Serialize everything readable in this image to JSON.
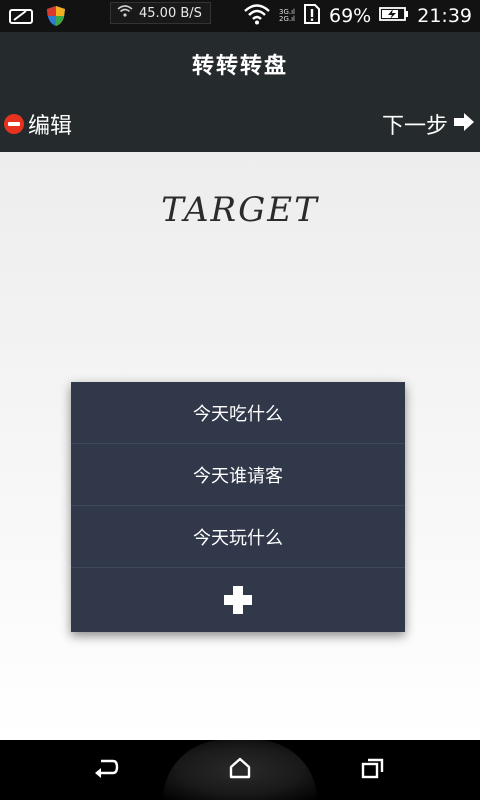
{
  "status_bar": {
    "network_speed": "45.00 B/S",
    "net_3g": "3G.ıl",
    "net_2g": "2G.ıl",
    "battery_percent": "69%",
    "time": "21:39"
  },
  "header": {
    "title": "转转转盘",
    "edit_label": "编辑",
    "next_label": "下一步"
  },
  "main": {
    "target_label": "TARGET",
    "menu_items": [
      {
        "label": "今天吃什么"
      },
      {
        "label": "今天谁请客"
      },
      {
        "label": "今天玩什么"
      }
    ]
  },
  "colors": {
    "header_bg": "#252a2c",
    "menu_bg": "#30384a",
    "edit_accent": "#e63320"
  },
  "icons": {
    "edit": "minus-circle-icon",
    "next": "arrow-right-icon",
    "add": "plus-icon",
    "nav_back": "back-icon",
    "nav_home": "home-icon",
    "nav_recent": "recent-apps-icon"
  }
}
